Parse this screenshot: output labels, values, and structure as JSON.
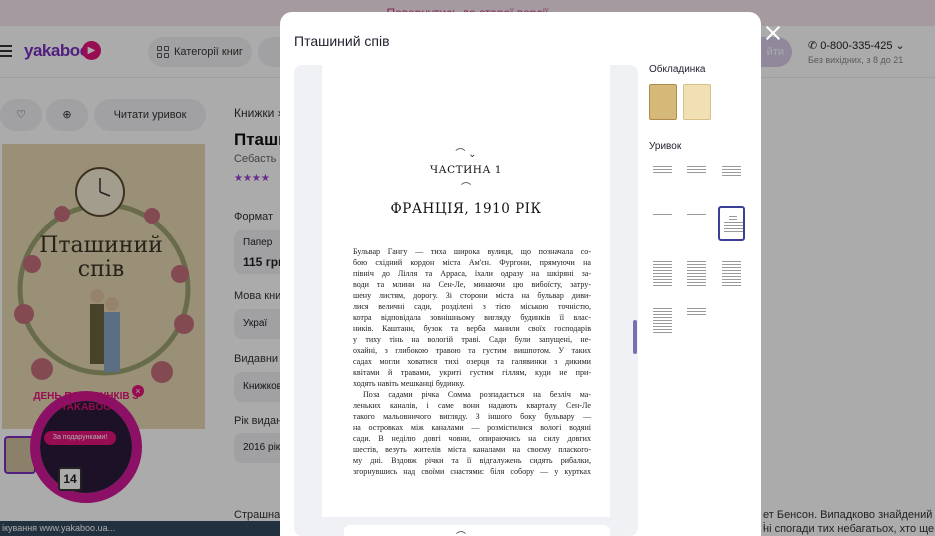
{
  "background": {
    "topbar_text": "Повернутись до старої версії",
    "logo": "yakaboo",
    "categories_label": "Категорії книг",
    "login_label": "йти",
    "phone": "0-800-335-425",
    "phone_hours": "Без вихідних, з 8 до 21",
    "read_excerpt_label": "Читати уривок",
    "breadcrumb": "Книжки",
    "book_title": "Пташи",
    "book_author": "Себасть",
    "rating_stars": "★★★★",
    "cover_title": "Пташиний спів",
    "format_label": "Формат",
    "format_value": "Папер",
    "price": "115 грн",
    "language_label": "Мова кни",
    "language_value": "Украї",
    "publisher_label": "Видавни",
    "publisher_value": "Книжков",
    "year_label": "Рік видан",
    "year_value": "2016 рік",
    "desc_heading": "Страшна",
    "desc_right_1": "ет Бенсон. Випадково знайдений і",
    "desc_right_2": "ні спогади тих небагатьох, хто ще",
    "status_text": "ікування www.yakaboo.ua...",
    "promo": {
      "title": "ДЕНЬ ПОДАРУНКІВ З YAKABOO",
      "tag": "За подарунками!",
      "date": "14"
    }
  },
  "modal": {
    "title": "Пташиний спів",
    "cover_section": "Обкладинка",
    "excerpt_section": "Уривок",
    "page": {
      "part": "ЧАСТИНА 1",
      "heading": "ФРАНЦІЯ, 1910 РІК",
      "lines": [
        "Бульвар Гангу — тиха широка вулиця, що позначала со-",
        "бою східний кордон міста Ам'єн. Фургони, прямуючи на",
        "північ до Лілля та Арраса, їхали одразу на шкіряні за-",
        "води та млини на Сен-Ле, минаючи цю вибоїсту, затру-",
        "шену листям, дорогу. Зі сторони міста на бульвар диви-",
        "лися величні сади, розділені з тією міською точністю,",
        "котра відповідала зовнішньому вигляду будинків її влас-",
        "ників. Каштани, бузок та верба манили своїх господарів",
        "у тиху тінь на вологій траві. Сади були запущені, не-",
        "охайні, з глибокою травою та густим вишпотом. У таких",
        "садах могли ховатися тихі озерця та галявинки з дикими",
        "квітами й травами, укриті густим гіллям, куди не при-",
        "ходять навіть мешканці будинку.",
        "Поза садами річка Сомма розпадається на безліч ма-",
        "леньких каналів, і саме вони надають кварталу Сен-Ле",
        "такого мальовничого вигляду. З іншого боку бульвару —",
        "на островках між каналами — розмістилися вологі водяні",
        "сади. В неділю довгі човни, опираючись на силу довгих",
        "шестів, везуть жителів міста каналами на своєму плаского-",
        "му дні. Вздовж річки та її відгалужень сидять рибалки,",
        "згорнувшись над своїми снастями: біля собору — у куртках"
      ]
    }
  },
  "colors": {
    "accent": "#7b2fbf",
    "brand_pink": "#e3127b",
    "selected_thumb": "#3b3f96"
  }
}
